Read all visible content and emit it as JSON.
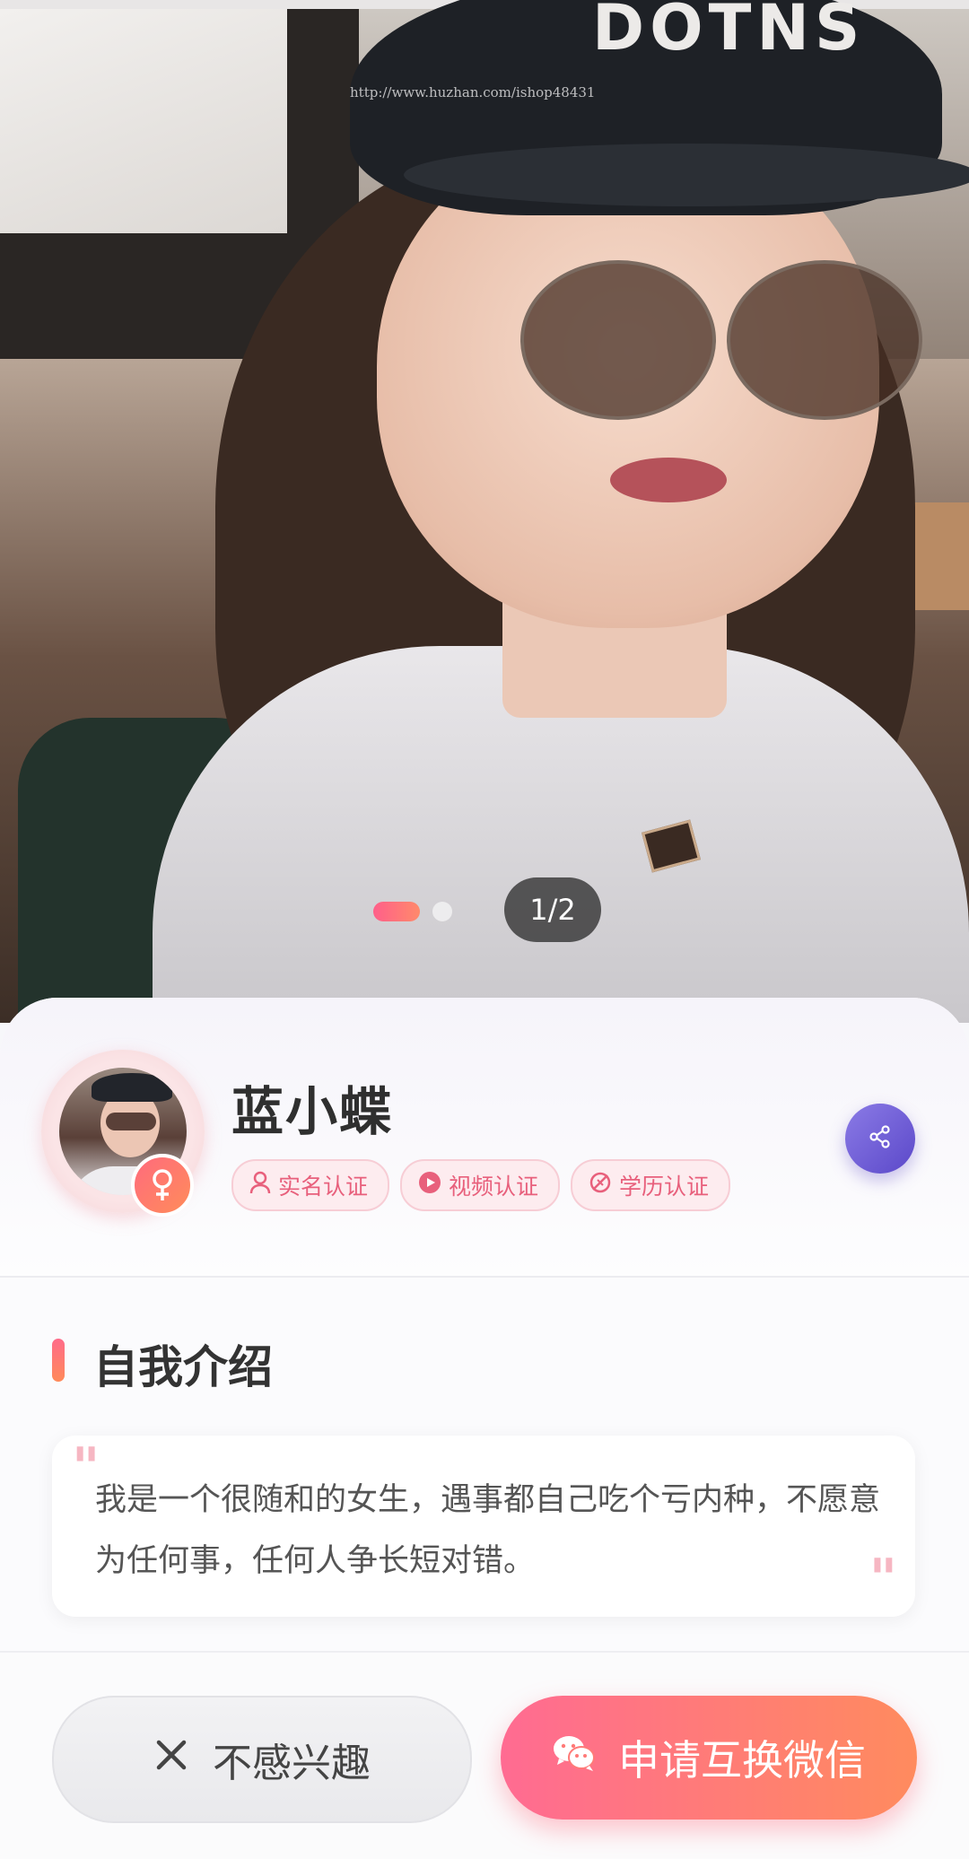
{
  "photo": {
    "watermark": "http://www.huzhan.com/ishop48431",
    "cap_text": "DOTNS",
    "counter": "1/2",
    "current_index": 1,
    "total": 2
  },
  "profile": {
    "name": "蓝小蝶",
    "gender_icon": "female-icon",
    "badges": [
      {
        "label": "实名认证",
        "icon": "person-icon"
      },
      {
        "label": "视频认证",
        "icon": "play-icon"
      },
      {
        "label": "学历认证",
        "icon": "education-icon"
      }
    ],
    "share_icon": "share-icon"
  },
  "intro": {
    "title": "自我介绍",
    "text": "我是一个很随和的女生，遇事都自己吃个亏内种，不愿意为任何事，任何人争长短对错。"
  },
  "actions": {
    "decline_label": "不感兴趣",
    "accept_label": "申请互换微信"
  },
  "colors": {
    "accent_gradient_start": "#ff6b92",
    "accent_gradient_end": "#ff8b5e",
    "share_purple": "#6b5ad6",
    "badge_text": "#e8607c"
  }
}
